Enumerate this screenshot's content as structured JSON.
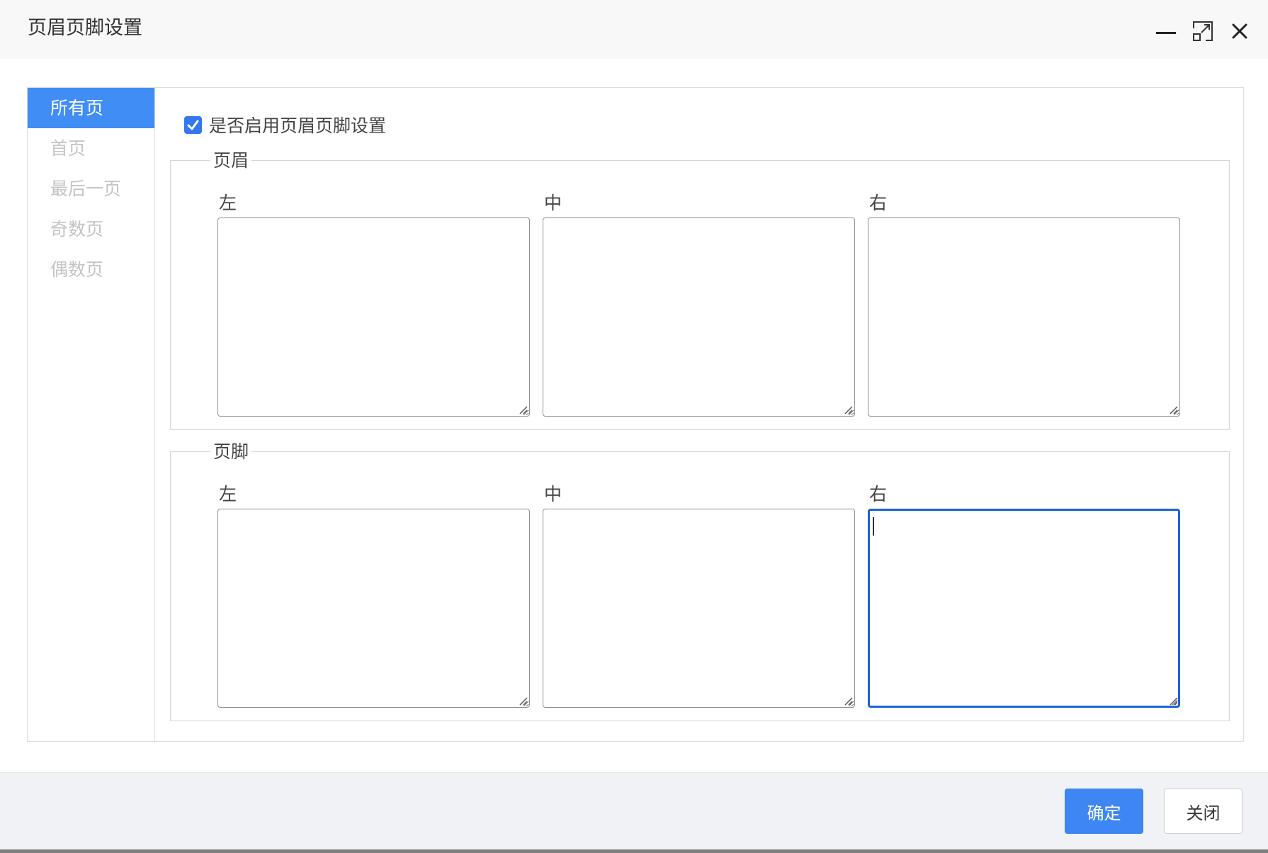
{
  "dialog": {
    "title": "页眉页脚设置",
    "controls": {
      "minimize": "minimize-icon",
      "maximize": "maximize-icon",
      "close": "close-icon"
    }
  },
  "sidebar": {
    "items": [
      {
        "label": "所有页",
        "active": true
      },
      {
        "label": "首页",
        "active": false
      },
      {
        "label": "最后一页",
        "active": false
      },
      {
        "label": "奇数页",
        "active": false
      },
      {
        "label": "偶数页",
        "active": false
      }
    ]
  },
  "enable": {
    "label": "是否启用页眉页脚设置",
    "checked": true
  },
  "header_section": {
    "legend": "页眉",
    "left": {
      "label": "左",
      "value": ""
    },
    "center": {
      "label": "中",
      "value": ""
    },
    "right": {
      "label": "右",
      "value": ""
    }
  },
  "footer_section": {
    "legend": "页脚",
    "left": {
      "label": "左",
      "value": ""
    },
    "center": {
      "label": "中",
      "value": ""
    },
    "right": {
      "label": "右",
      "value": "",
      "focused": true
    }
  },
  "buttons": {
    "ok": "确定",
    "close": "关闭"
  },
  "colors": {
    "accent": "#3f8df5",
    "focus_border": "#1a62d8",
    "checkbox": "#3477f0"
  }
}
